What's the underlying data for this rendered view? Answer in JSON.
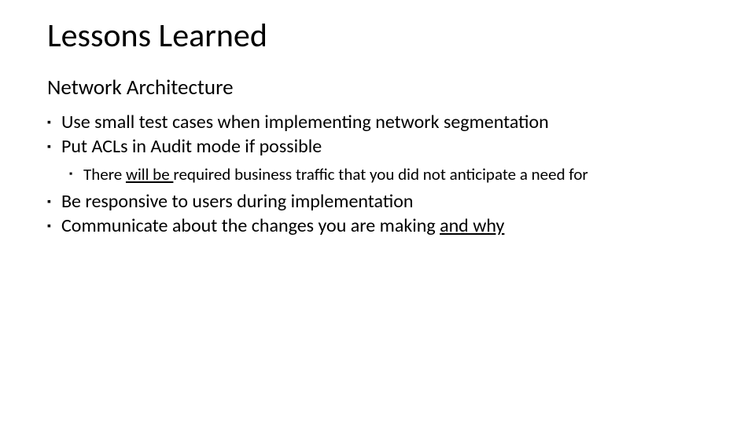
{
  "slide": {
    "title": "Lessons Learned",
    "subtitle": "Network Architecture",
    "bullets": {
      "b1": "Use small test cases when implementing network segmentation",
      "b2": "Put ACLs in Audit mode if possible",
      "b2_sub": {
        "pre": "There ",
        "u": "will be ",
        "post": "required business traffic that you did not anticipate a need for"
      },
      "b3": "Be responsive to users during implementation",
      "b4": {
        "pre": "Communicate about the changes you are making ",
        "u": "and why"
      }
    }
  }
}
